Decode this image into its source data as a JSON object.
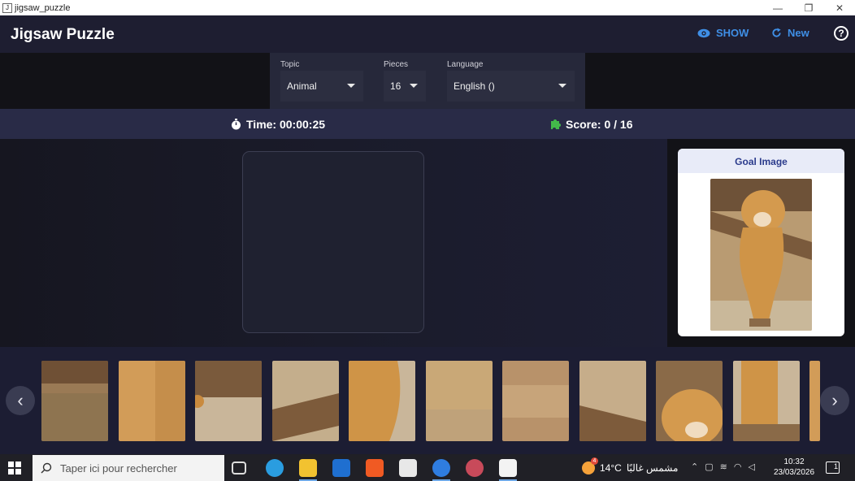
{
  "window": {
    "title": "jigsaw_puzzle",
    "controls": [
      "—",
      "❐",
      "✕"
    ]
  },
  "appbar": {
    "title": "Jigsaw Puzzle",
    "show_label": "SHOW",
    "new_label": "New",
    "help_glyph": "?",
    "accent": "#3f8fe6"
  },
  "controls": {
    "topic": {
      "label": "Topic",
      "value": "Animal"
    },
    "pieces": {
      "label": "Pieces",
      "value": "16"
    },
    "language": {
      "label": "Language",
      "value": "English ()"
    }
  },
  "status": {
    "time_label": "Time: 00:00:25",
    "score_label": "Score: 0 / 16",
    "score_icon_color": "#43b84a"
  },
  "goal": {
    "title": "Goal Image"
  },
  "tray": {
    "prev_glyph": "‹",
    "next_glyph": "›",
    "piece_count_visible": 11
  },
  "taskbar": {
    "search_placeholder": "Taper ici pour rechercher",
    "weather_temp": "14°C",
    "weather_text": "مشمس غالبًا",
    "weather_badge": "4",
    "time": "10:32",
    "date": "23/03/2026",
    "notification_count": "1"
  }
}
